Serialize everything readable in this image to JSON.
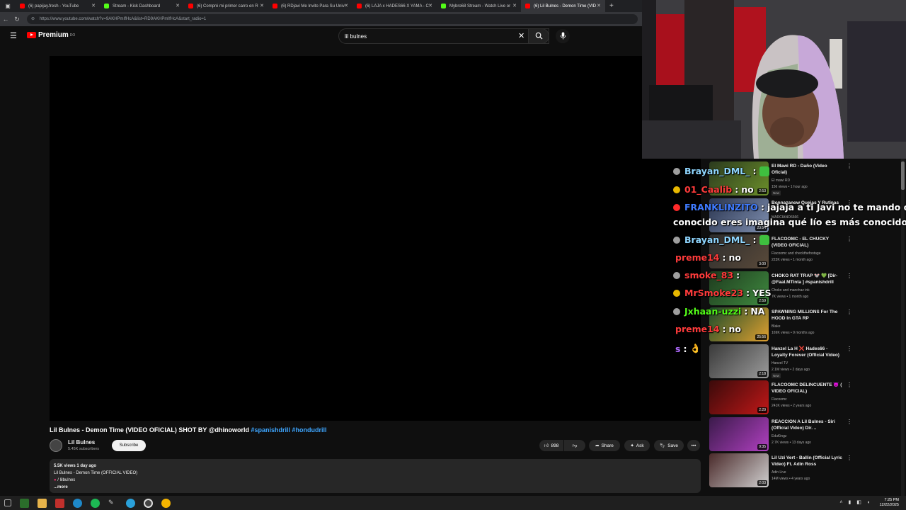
{
  "browser": {
    "tabs": [
      {
        "label": "(6) papijay.fresh - YouTube",
        "color": "#ff0000"
      },
      {
        "label": "Stream - Kick Dashboard",
        "color": "#53fc18"
      },
      {
        "label": "(6) Compré mi primer carro en R",
        "color": "#ff0000"
      },
      {
        "label": "(6) RDjavi Me Invito Para Su Univ",
        "color": "#ff0000"
      },
      {
        "label": "(6) LAJA x HADES66 X YAMA - C",
        "color": "#ff0000"
      },
      {
        "label": "Mybro68 Stream - Watch Live or",
        "color": "#53fc18"
      },
      {
        "label": "(6) Lil Bulnes - Demon Time (VID",
        "color": "#ff0000",
        "active": true
      }
    ],
    "new_tab": "+",
    "url": "https://www.youtube.com/watch?v=9AKHPmIfHcA&list=RD9AKHPmIfHcA&start_radio=1"
  },
  "youtube": {
    "logo_text": "Premium",
    "logo_sup": "DO",
    "search_value": "lil bulnes",
    "video": {
      "title": "Lil Bulnes - Demon Time (VIDEO OFICIAL) SHOT BY @dhinoworld ",
      "hashtags": "#spanishdrill #hondudrill",
      "channel": "Lil Bulnes",
      "subscribers": "5.45K subscribers",
      "subscribe_label": "Subscribe",
      "likes": "898",
      "share_label": "Share",
      "ask_label": "Ask",
      "save_label": "Save",
      "description": {
        "stats": "5.5K views  1 day ago",
        "line1": "Lil Bulnes - Demon Time (OFFICIAL VIDEO)",
        "line2": "/ lilbulnes",
        "more": "...more"
      }
    },
    "recommendations": [
      {
        "title": "El Mawi RD - Daño (Video Oficial)",
        "channel": "El mawi RD",
        "meta": "156 views • 1 hour ago",
        "new": "New",
        "duration": "2:53",
        "c1": "#2b3a1e",
        "c2": "#6b8f2a"
      },
      {
        "title": "Bonnazanow Quejas Y Rutinas",
        "channel": "MARCIANO6666",
        "meta": "",
        "new": "New",
        "duration": "23:54",
        "c1": "#2a3550",
        "c2": "#7f8fb0"
      },
      {
        "title": "FLACOOMC - EL CHUCKY (VIDEO OFICIAL)",
        "channel": "Flacoomc and checkthefootage",
        "meta": "223K views • 1 month ago",
        "new": "",
        "duration": "3:00",
        "c1": "#2d2d2d",
        "c2": "#5a4a3a"
      },
      {
        "title": "CHOKO RAT TRAP 🐭 💚 [Dir- @Faal.MTinta ] #spanishdrill",
        "channel": "Choko and manchaz ink",
        "meta": "7K views • 1 month ago",
        "new": "",
        "duration": "2:59",
        "c1": "#1e3a1e",
        "c2": "#3f8a3f"
      },
      {
        "title": "SPAWNING MILLIONS For The HOOD In GTA RP",
        "channel": "Blake",
        "meta": "169K views • 9 months ago",
        "new": "",
        "duration": "25:56",
        "c1": "#1a4a2a",
        "c2": "#e0a030"
      },
      {
        "title": "Hanzel La H ❌ Hades66 - Loyalty Forever (Official Video)",
        "channel": "Hanzel TV",
        "meta": "2.1M views • 2 days ago",
        "new": "New",
        "duration": "2:18",
        "c1": "#3a3a3a",
        "c2": "#9a9a9a"
      },
      {
        "title": "FLACOOMC DELINCUENTE 😈 ( VIDEO OFICIAL)",
        "channel": "Flacoomc",
        "meta": "241K views • 2 years ago",
        "new": "",
        "duration": "2:29",
        "c1": "#3a0a0a",
        "c2": "#c01818"
      },
      {
        "title": "REACCION A Lil Bulnes - Siri (Official Video) Dir. ..",
        "channel": "EduKingz",
        "meta": "2.7K views • 13 days ago",
        "new": "",
        "duration": "9:35",
        "c1": "#3a1a4a",
        "c2": "#b040c0"
      },
      {
        "title": "Lil Uzi Vert - Ballin (Official Lyric Video) Ft. Adin Ross",
        "channel": "Adin Live",
        "meta": "14M views • 4 years ago",
        "new": "",
        "duration": "2:03",
        "c1": "#4a2a2a",
        "c2": "#d0d0d0"
      }
    ]
  },
  "chat": [
    {
      "badge": "#9e9e9e",
      "user": "Brayan_DML_",
      "user_color": "#8fd6ff",
      "sep": ":",
      "msg": "",
      "emote": true
    },
    {
      "badge": "#e8b800",
      "user": "01_Caalib",
      "user_color": "#ff3b3b",
      "sep": ":",
      "msg": "no",
      "emote": false
    },
    {
      "badge": "#ff2a2a",
      "user": "FRANKLINZITO",
      "user_color": "#3f7bff",
      "sep": ":",
      "msg": "jajaja a ti Javi no te mando c",
      "emote": false
    },
    {
      "badge": "",
      "user": "",
      "user_color": "#ffffff",
      "sep": "",
      "msg": "conocido eres imagina qué lío es más conocido que tu",
      "emote": false
    },
    {
      "badge": "#9e9e9e",
      "user": "Brayan_DML_",
      "user_color": "#8fd6ff",
      "sep": ":",
      "msg": "",
      "emote": true
    },
    {
      "badge": "",
      "user": "preme14",
      "user_color": "#ff3b3b",
      "sep": ":",
      "msg": "no",
      "emote": false
    },
    {
      "badge": "#9e9e9e",
      "user": "smoke_83",
      "user_color": "#ff3b3b",
      "sep": ":",
      "msg": "",
      "emote": false
    },
    {
      "badge": "#e8b800",
      "user": "MrSmoke23",
      "user_color": "#ff3b3b",
      "sep": ":",
      "msg": "YES",
      "emote": false
    },
    {
      "badge": "#9e9e9e",
      "user": "Jxhaan-uzzi",
      "user_color": "#53fc18",
      "sep": ":",
      "msg": "NA",
      "emote": false
    },
    {
      "badge": "",
      "user": "preme14",
      "user_color": "#ff3b3b",
      "sep": ":",
      "msg": "no",
      "emote": false
    },
    {
      "badge": "",
      "user": "s",
      "user_color": "#b06bff",
      "sep": ":",
      "msg": "👌",
      "emote": false
    }
  ],
  "taskbar": {
    "time": "7:25 PM",
    "date": "12/22/2025"
  }
}
